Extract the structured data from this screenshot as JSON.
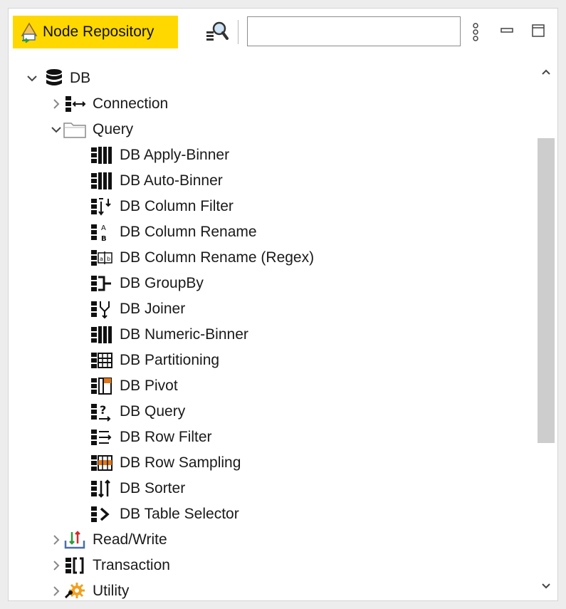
{
  "panel": {
    "title": "Node Repository",
    "search_placeholder": "",
    "accent": "#ffd800"
  },
  "tree": {
    "root": {
      "label": "DB",
      "expanded": true
    },
    "connection": {
      "label": "Connection",
      "expanded": false
    },
    "query": {
      "label": "Query",
      "expanded": true,
      "items": [
        {
          "label": "DB Apply-Binner"
        },
        {
          "label": "DB Auto-Binner"
        },
        {
          "label": "DB Column Filter"
        },
        {
          "label": "DB Column Rename"
        },
        {
          "label": "DB Column Rename (Regex)"
        },
        {
          "label": "DB GroupBy"
        },
        {
          "label": "DB Joiner"
        },
        {
          "label": "DB Numeric-Binner"
        },
        {
          "label": "DB Partitioning"
        },
        {
          "label": "DB Pivot"
        },
        {
          "label": "DB Query"
        },
        {
          "label": "DB Row Filter"
        },
        {
          "label": "DB Row Sampling"
        },
        {
          "label": "DB Sorter"
        },
        {
          "label": "DB Table Selector"
        }
      ]
    },
    "read_write": {
      "label": "Read/Write",
      "expanded": false
    },
    "transaction": {
      "label": "Transaction",
      "expanded": false
    },
    "utility": {
      "label": "Utility",
      "expanded": false
    }
  },
  "icons": {
    "tab": "node-repository-icon",
    "search": "search-nodes-icon",
    "menu": "view-menu-icon",
    "minimize": "minimize-icon",
    "maximize": "maximize-icon"
  }
}
